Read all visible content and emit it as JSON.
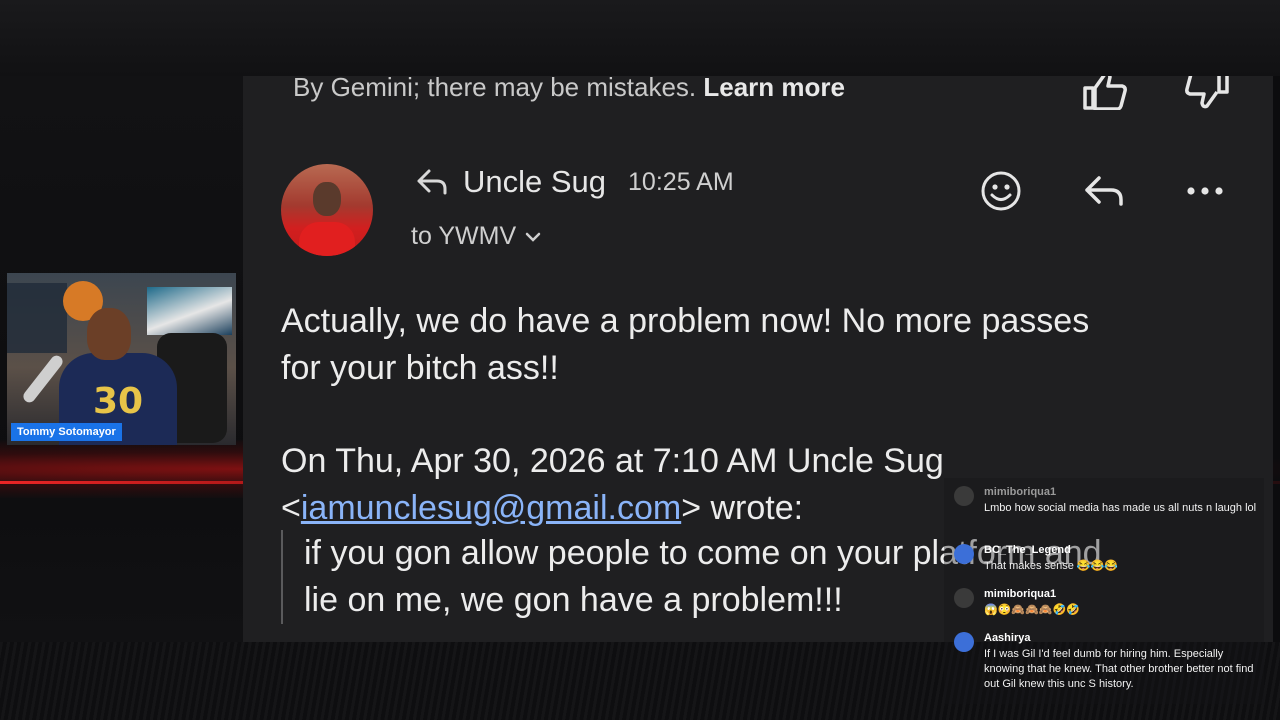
{
  "email": {
    "gemini_note": "By Gemini; there may be mistakes.",
    "learn_more": "Learn more",
    "sender_name": "Uncle Sug",
    "time": "10:25 AM",
    "to_line": "to YWMV",
    "body_line1": "Actually, we do have a problem now! No more passes",
    "body_line2": "for your bitch ass!!",
    "quote_prefix": "On Thu, Apr 30, 2026 at 7:10 AM Uncle Sug",
    "quote_lt": "<",
    "quote_email": "iamunclesug@gmail.com",
    "quote_suffix": "> wrote:",
    "quote_line1": "if you gon allow people to come on your platform and",
    "quote_line2": "lie on me, we gon have a problem!!!"
  },
  "webcam": {
    "name_tag": "Tommy Sotomayor",
    "jersey_number": "30"
  },
  "chat": {
    "messages": [
      {
        "user": "mimiboriqua1",
        "text": "Lmbo how social media has made us all nuts n laugh lol",
        "name_color": "#9a9a9a",
        "avatar_color": "#3a3a3a"
      },
      {
        "user": "BC_The_Legend",
        "text": "That makes sense 😂😂😂",
        "name_color": "#ffffff",
        "avatar_color": "#3c6fd8"
      },
      {
        "user": "mimiboriqua1",
        "text": "😱😳🙈🙈🙈🤣🤣",
        "name_color": "#ffffff",
        "avatar_color": "#3a3a3a"
      },
      {
        "user": "Aashirya",
        "text": "If I was Gil I'd feel dumb for hiring him. Especially knowing that he knew. That other brother better not find out Gil knew this unc S history.",
        "name_color": "#ffffff",
        "avatar_color": "#3c6fd8"
      }
    ]
  }
}
